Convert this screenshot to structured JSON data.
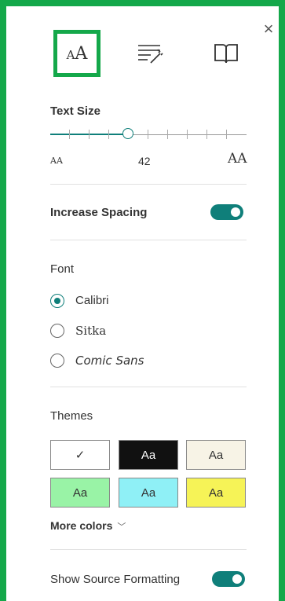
{
  "header": {
    "close_icon": "close-icon",
    "tabs": [
      {
        "name": "text-preferences",
        "icon": "text-size-icon",
        "selected": true,
        "label_big": "A",
        "label_small": "A"
      },
      {
        "name": "grammar-tools",
        "icon": "grammar-tools-icon"
      },
      {
        "name": "reading-preferences",
        "icon": "book-icon"
      }
    ],
    "close_glyph": "×"
  },
  "text_size": {
    "label": "Text Size",
    "value": "42",
    "small_label": "AA",
    "large_label": "AA",
    "slider_fraction": 0.4
  },
  "spacing": {
    "label": "Increase Spacing",
    "enabled": true
  },
  "font": {
    "label": "Font",
    "options": [
      "Calibri",
      "Sitka",
      "Comic Sans"
    ],
    "selected": "Calibri"
  },
  "themes": {
    "label": "Themes",
    "swatches": [
      {
        "label": "✓",
        "bg": "#ffffff",
        "fg": "#333333",
        "selected": true
      },
      {
        "label": "Aa",
        "bg": "#111111",
        "fg": "#ffffff"
      },
      {
        "label": "Aa",
        "bg": "#f7f3e6",
        "fg": "#333333"
      },
      {
        "label": "Aa",
        "bg": "#99f3a6",
        "fg": "#333333"
      },
      {
        "label": "Aa",
        "bg": "#8ff0f6",
        "fg": "#333333"
      },
      {
        "label": "Aa",
        "bg": "#f6f357",
        "fg": "#333333"
      }
    ],
    "more_label": "More colors",
    "more_chevron": "﹀"
  },
  "source_formatting": {
    "label": "Show Source Formatting",
    "enabled": true
  },
  "colors": {
    "accent": "#0f7f7a",
    "highlight_border": "#14a84a"
  }
}
